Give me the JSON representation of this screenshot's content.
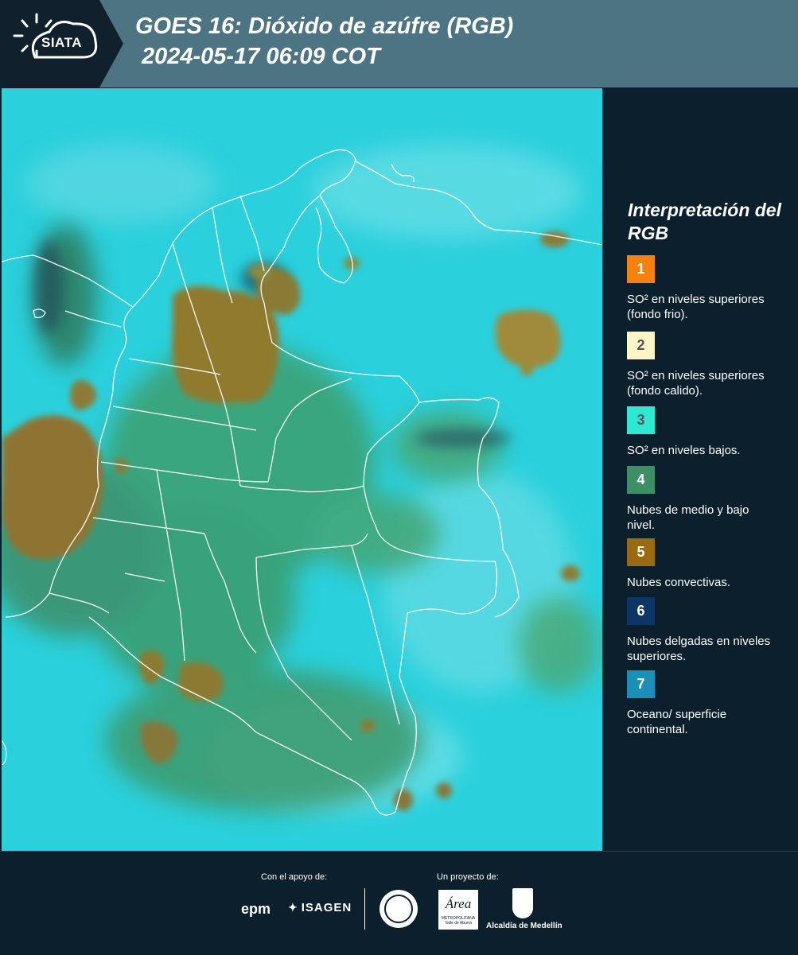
{
  "header": {
    "logo_text": "SIATA",
    "title_line1": "GOES 16: Dióxido de azúfre (RGB)",
    "title_line2": "2024-05-17 06:09 COT",
    "logo_band_color": "#10212d",
    "header_color": "#4d7482"
  },
  "map": {
    "icon": "satellite-map-image",
    "ocean_land_color": "#2ad0dc",
    "cloud_green_color": "#3a9e63",
    "convective_color": "#9c7a2a"
  },
  "legend": {
    "title": "Interpretación del RGB",
    "items": [
      {
        "number": "1",
        "color": "#f5820f",
        "label": "SO² en niveles superiores (fondo frio)."
      },
      {
        "number": "2",
        "color": "#fbf5c8",
        "label": "SO² en niveles superiores (fondo calido)."
      },
      {
        "number": "3",
        "color": "#2fe8d2",
        "label": "SO² en niveles bajos."
      },
      {
        "number": "4",
        "color": "#3f8f66",
        "label": "Nubes de medio y bajo nivel."
      },
      {
        "number": "5",
        "color": "#9a6a12",
        "label": "Nubes convectivas."
      },
      {
        "number": "6",
        "color": "#0d3566",
        "label": "Nubes delgadas en niveles superiores."
      },
      {
        "number": "7",
        "color": "#1a8fb8",
        "label": "Oceano/ superficie continental."
      }
    ]
  },
  "footer": {
    "support_label": "Con el apoyo de:",
    "project_label": "Un proyecto de:",
    "epm_text": "epm",
    "isagen_text": "ISAGEN",
    "area_text": "Área",
    "area_subtext": "METROPOLITANA Valle de Aburrá",
    "alcaldia_text": "Alcaldía de Medellín"
  }
}
